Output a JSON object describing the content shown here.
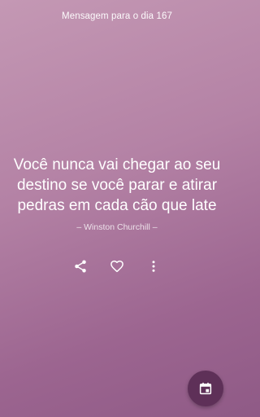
{
  "header": {
    "title": "Mensagem para o dia 167"
  },
  "quote": {
    "lines": [
      "Você nunca vai chegar ao seu",
      "destino se você parar e atirar",
      "pedras em cada cão que late"
    ],
    "author": "– Winston Churchill –"
  },
  "actions": {
    "share_icon": "share-icon",
    "favorite_icon": "heart-outline-icon",
    "more_icon": "more-vert-icon"
  },
  "fab": {
    "icon": "calendar-icon"
  },
  "colors": {
    "background_top": "#c498b4",
    "background_bottom": "#8f5a86",
    "fab": "#5e3058",
    "text": "#ffffff"
  }
}
